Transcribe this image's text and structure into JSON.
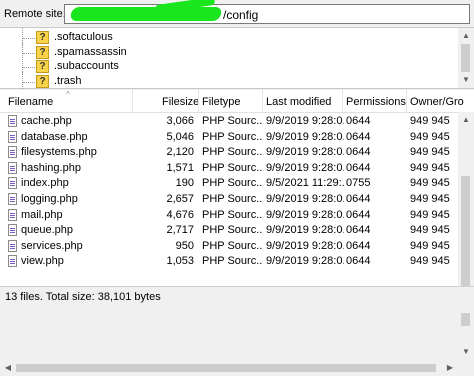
{
  "remote_site": {
    "label": "Remote site:",
    "value_visible": "/config"
  },
  "tree": {
    "items": [
      ".softaculous",
      ".spamassassin",
      ".subaccounts",
      ".trash"
    ]
  },
  "columns": [
    "Filename",
    "Filesize",
    "Filetype",
    "Last modified",
    "Permissions",
    "Owner/Gro"
  ],
  "files": [
    {
      "name": "cache.php",
      "size": "3,066",
      "type": "PHP Sourc...",
      "modified": "9/9/2019 9:28:0...",
      "perm": "0644",
      "owner": "949 945"
    },
    {
      "name": "database.php",
      "size": "5,046",
      "type": "PHP Sourc...",
      "modified": "9/9/2019 9:28:0...",
      "perm": "0644",
      "owner": "949 945"
    },
    {
      "name": "filesystems.php",
      "size": "2,120",
      "type": "PHP Sourc...",
      "modified": "9/9/2019 9:28:0...",
      "perm": "0644",
      "owner": "949 945"
    },
    {
      "name": "hashing.php",
      "size": "1,571",
      "type": "PHP Sourc...",
      "modified": "9/9/2019 9:28:0...",
      "perm": "0644",
      "owner": "949 945"
    },
    {
      "name": "index.php",
      "size": "190",
      "type": "PHP Sourc...",
      "modified": "9/5/2021 11:29:...",
      "perm": "0755",
      "owner": "949 945"
    },
    {
      "name": "logging.php",
      "size": "2,657",
      "type": "PHP Sourc...",
      "modified": "9/9/2019 9:28:0...",
      "perm": "0644",
      "owner": "949 945"
    },
    {
      "name": "mail.php",
      "size": "4,676",
      "type": "PHP Sourc...",
      "modified": "9/9/2019 9:28:0...",
      "perm": "0644",
      "owner": "949 945"
    },
    {
      "name": "queue.php",
      "size": "2,717",
      "type": "PHP Sourc...",
      "modified": "9/9/2019 9:28:0...",
      "perm": "0644",
      "owner": "949 945"
    },
    {
      "name": "services.php",
      "size": "950",
      "type": "PHP Sourc...",
      "modified": "9/9/2019 9:28:0...",
      "perm": "0644",
      "owner": "949 945"
    },
    {
      "name": "view.php",
      "size": "1,053",
      "type": "PHP Sourc...",
      "modified": "9/9/2019 9:28:0...",
      "perm": "0644",
      "owner": "949 945"
    }
  ],
  "status_text": "13 files. Total size: 38,101 bytes",
  "colors": {
    "redaction": "#19e61c",
    "folder_unknown": "#f8d34a"
  },
  "icons": {
    "tree_item": "question-folder-icon",
    "file": "php-file-icon"
  }
}
